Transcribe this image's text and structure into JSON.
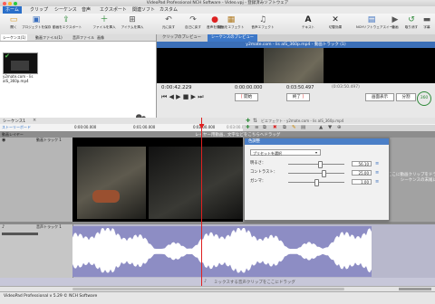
{
  "window": {
    "title": "VideoPad Professional NCH Software - Video.vpj - 登録済みソフトウェア"
  },
  "menu": [
    "ホーム",
    "クリップ",
    "シーケンス",
    "音声",
    "エクスポート",
    "関連ソフト",
    "カスタム"
  ],
  "toolbar": [
    {
      "label": "開く",
      "icon": "open-icon"
    },
    {
      "label": "プロジェクトを保存",
      "icon": "save-project-icon"
    },
    {
      "label": "動画をエクスポート",
      "icon": "export-video-icon"
    },
    {
      "label": "ファイルを挿入",
      "icon": "insert-file-icon"
    },
    {
      "label": "アイテムを挿入",
      "icon": "insert-item-icon"
    },
    {
      "label": "元に戻す",
      "icon": "undo-icon"
    },
    {
      "label": "自己に戻す",
      "icon": "redo-icon"
    },
    {
      "label": "音声を録音",
      "icon": "record-audio-icon"
    },
    {
      "label": "動画をエフェクト",
      "icon": "video-effects-icon"
    },
    {
      "label": "音声エフェクト",
      "icon": "audio-effects-icon"
    },
    {
      "label": "テキスト",
      "icon": "text-icon"
    },
    {
      "label": "切替効果",
      "icon": "transition-icon"
    },
    {
      "label": "NCHソフトウェアスイート",
      "icon": "nch-suite-icon"
    },
    {
      "label": "動画",
      "icon": "video-icon"
    },
    {
      "label": "取り消す",
      "icon": "cancel-icon"
    },
    {
      "label": "字幕",
      "icon": "subtitle-icon"
    }
  ],
  "bin": {
    "tabs": [
      "シーケンス(1)",
      "動画ファイル(1)",
      "音声ファイル",
      "画像"
    ],
    "clip_name": "y2mate.com - lis\nalS_360p.mp4",
    "active_tab_index": 0
  },
  "preview": {
    "tabs": [
      "クリップのプレビュー",
      "シーケンスのプレビュー"
    ],
    "title": "y2mate.com - lis alS_360p.mp4 - 動画トラック (1)",
    "time_current": "0:00:42.229",
    "time_in": "0:00:00.000",
    "time_out": "0:03:50.497",
    "time_total": "(0:03:50.497)",
    "start_label": "開始",
    "end_label": "終了",
    "view_label": "画面表示",
    "split_label": "分割",
    "rotate_label": "360"
  },
  "timeline": {
    "sequence_tab": "シーケンス1",
    "tab_mode": "ストーリーボード",
    "ruler_times": [
      "0:00:00.000",
      "0:01:00.000",
      "0:02:00.000",
      "0:03:00.000"
    ],
    "video_layer_label": "動画レイヤー",
    "video_overlay_hint": "レイヤー用動画、文字などをこちらへドラッグ",
    "video_track_label": "動画トラック 1",
    "audio_track_label": "音声トラック 1",
    "audio_overlay_hint": "ミックスする音声クリップをここにドラッグ",
    "right_hint": "ここに動画クリップをドラッグ\nシーケンスの末尾に挿入"
  },
  "effects_bar": {
    "caption": "ビエフェクト - y2mate.com - lis alS_360p.mp4"
  },
  "dialog": {
    "title": "色調整",
    "preset": "プリセットを選択",
    "rows": [
      {
        "label": "明るさ：",
        "value": "56.10",
        "level": 0.56
      },
      {
        "label": "コントラスト：",
        "value": "25.00",
        "level": 0.625
      },
      {
        "label": "ガンマ：",
        "value": "1.00",
        "level": 0.5
      }
    ]
  },
  "status": {
    "text": "VideoPad Professional v 5.29 © NCH Software"
  },
  "colors": {
    "accent": "#2a6fc9",
    "playhead": "#e02020",
    "audio_wave": "#ffffff",
    "video_track_bg": "#a2a2a2"
  }
}
